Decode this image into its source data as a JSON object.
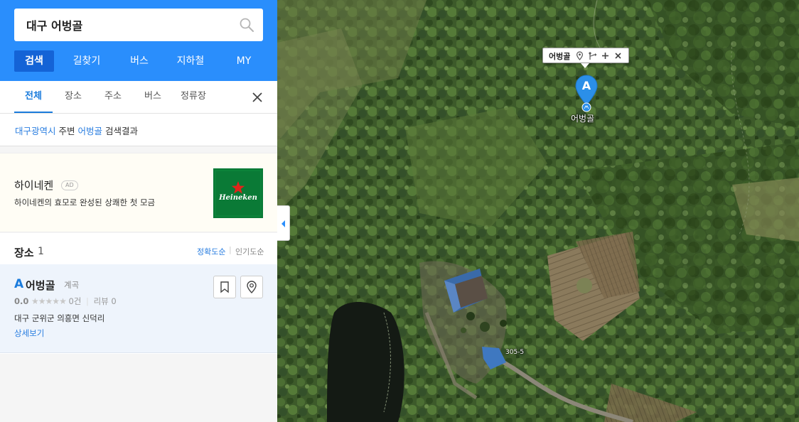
{
  "search": {
    "query": "대구 어벙골"
  },
  "main_tabs": [
    {
      "label": "검색",
      "active": true
    },
    {
      "label": "길찾기",
      "active": false
    },
    {
      "label": "버스",
      "active": false
    },
    {
      "label": "지하철",
      "active": false
    },
    {
      "label": "MY",
      "active": false
    }
  ],
  "sub_tabs": [
    {
      "label": "전체",
      "active": true
    },
    {
      "label": "장소",
      "active": false
    },
    {
      "label": "주소",
      "active": false
    },
    {
      "label": "버스",
      "active": false
    },
    {
      "label": "정류장",
      "active": false
    }
  ],
  "result_summary": {
    "region": "대구광역시",
    "around": "주변",
    "keyword": "어벙골",
    "suffix": "검색결과"
  },
  "ad": {
    "title": "하이네켄",
    "badge": "AD",
    "description": "하이네켄의 효모로 완성된 상쾌한 첫 모금",
    "image_text": "Heineken"
  },
  "places": {
    "title": "장소",
    "count": "1",
    "sort_accuracy": "정확도순",
    "sort_separator": "|",
    "sort_popular": "인기도순",
    "items": [
      {
        "marker": "A",
        "name": "어벙골",
        "category": "계곡",
        "rating": "0.0",
        "stars": "★★★★★",
        "rating_count": "0건",
        "review_label": "리뷰 0",
        "address": "대구 군위군 의흥면 신덕리",
        "detail_link": "상세보기"
      }
    ]
  },
  "map": {
    "tooltip_name": "어벙골",
    "pin_letter": "A",
    "pin_label": "어벙골",
    "road_number": "305-5"
  },
  "colors": {
    "header_blue": "#2a8efc",
    "active_tab": "#1463d6",
    "link_blue": "#2a7ee0",
    "pin_blue": "#2b8fe8"
  }
}
